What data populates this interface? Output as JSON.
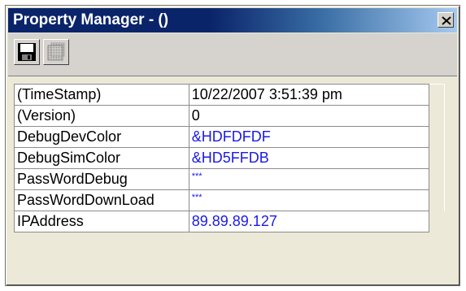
{
  "window": {
    "title": "Property Manager - ()",
    "close_icon": "close-icon"
  },
  "toolbar": {
    "save_icon": "floppy-save-icon",
    "copy_icon": "disabled-grid-icon"
  },
  "properties": [
    {
      "name": "(TimeStamp)",
      "value": "10/22/2007 3:51:39 pm",
      "color": "#000000"
    },
    {
      "name": "(Version)",
      "value": "0",
      "color": "#000000"
    },
    {
      "name": "DebugDevColor",
      "value": "&HDFDFDF",
      "color": "#1a1ae6"
    },
    {
      "name": "DebugSimColor",
      "value": "&HD5FFDB",
      "color": "#1a1ae6"
    },
    {
      "name": "PassWordDebug",
      "value": "***",
      "color": "#1a1ae6"
    },
    {
      "name": "PassWordDownLoad",
      "value": "***",
      "color": "#1a1ae6"
    },
    {
      "name": "IPAddress",
      "value": "89.89.89.127",
      "color": "#1a1ae6"
    }
  ]
}
